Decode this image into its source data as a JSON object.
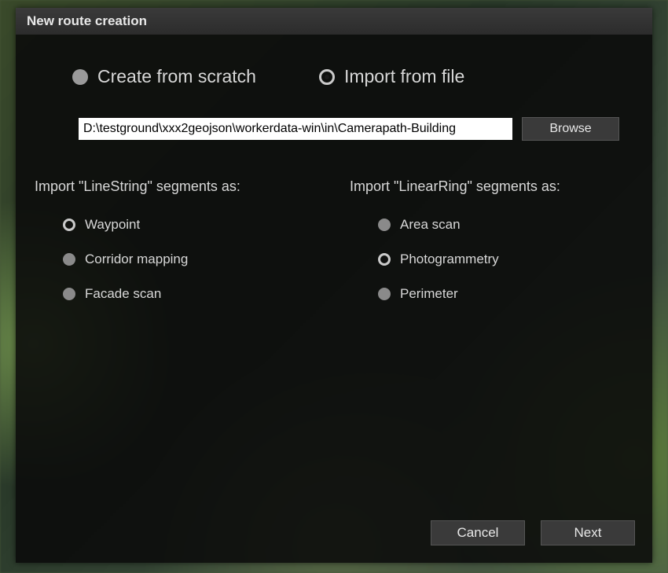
{
  "title": "New route creation",
  "mode": {
    "scratch": {
      "label": "Create from scratch",
      "selected": false
    },
    "import": {
      "label": "Import from file",
      "selected": true
    }
  },
  "file": {
    "path": "D:\\testground\\xxx2geojson\\workerdata-win\\in\\Camerapath-Building",
    "browse_label": "Browse"
  },
  "linestring": {
    "heading": "Import \"LineString\" segments as:",
    "options": [
      {
        "label": "Waypoint",
        "selected": true
      },
      {
        "label": "Corridor mapping",
        "selected": false
      },
      {
        "label": "Facade scan",
        "selected": false
      }
    ]
  },
  "linearring": {
    "heading": "Import \"LinearRing\" segments as:",
    "options": [
      {
        "label": "Area scan",
        "selected": false
      },
      {
        "label": "Photogrammetry",
        "selected": true
      },
      {
        "label": "Perimeter",
        "selected": false
      }
    ]
  },
  "footer": {
    "cancel": "Cancel",
    "next": "Next"
  }
}
